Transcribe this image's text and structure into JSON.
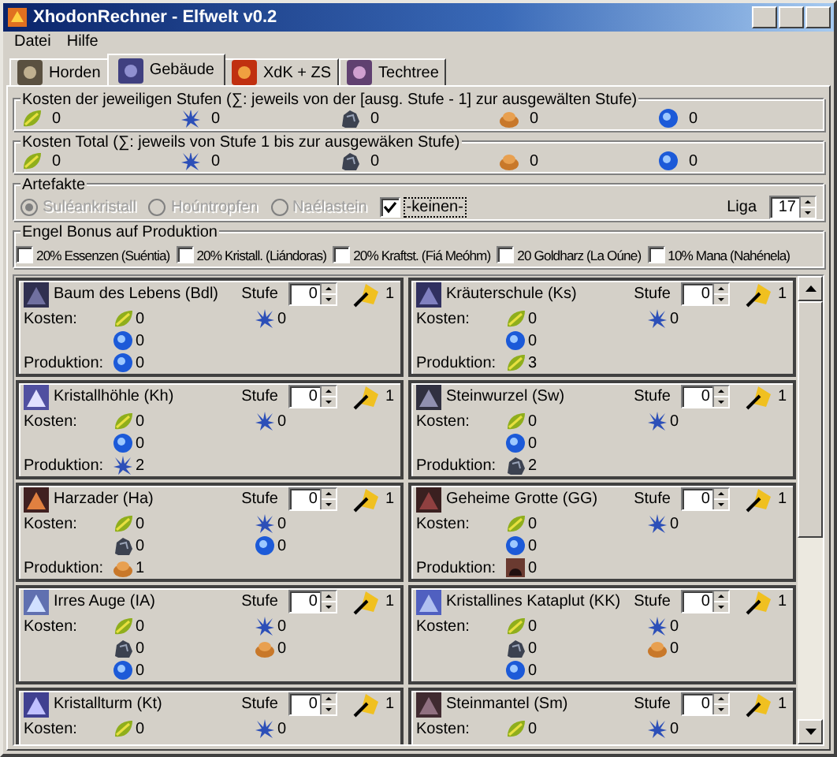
{
  "window": {
    "title": "XhodonRechner - Elfwelt v0.2"
  },
  "menu": [
    "Datei",
    "Hilfe"
  ],
  "tabs": [
    {
      "label": "Horden",
      "selected": false
    },
    {
      "label": "Gebäude",
      "selected": true
    },
    {
      "label": "XdK + ZS",
      "selected": false
    },
    {
      "label": "Techtree",
      "selected": false
    }
  ],
  "level_costs": {
    "title": "Kosten der jeweiligen Stufen (∑: jeweils von der [ausg. Stufe - 1] zur ausgewälten Stufe)",
    "values": [
      {
        "kind": "essence",
        "value": "0"
      },
      {
        "kind": "crystal",
        "value": "0"
      },
      {
        "kind": "stone",
        "value": "0"
      },
      {
        "kind": "resin",
        "value": "0"
      },
      {
        "kind": "mana",
        "value": "0"
      }
    ]
  },
  "total_costs": {
    "title": "Kosten Total (∑: jeweils von Stufe 1 bis zur ausgewäken Stufe)",
    "values": [
      {
        "kind": "essence",
        "value": "0"
      },
      {
        "kind": "crystal",
        "value": "0"
      },
      {
        "kind": "stone",
        "value": "0"
      },
      {
        "kind": "resin",
        "value": "0"
      },
      {
        "kind": "mana",
        "value": "0"
      }
    ]
  },
  "artifacts": {
    "title": "Artefakte",
    "options": [
      {
        "label": "Suléankristall",
        "selected": true,
        "disabled": true
      },
      {
        "label": "Hoúntropfen",
        "selected": false,
        "disabled": true
      },
      {
        "label": "Naélastein",
        "selected": false,
        "disabled": true
      }
    ],
    "none_option": {
      "label": "-keinen-",
      "checked": true
    },
    "league": {
      "label": "Liga",
      "value": "17"
    }
  },
  "angel_bonus": {
    "title": "Engel Bonus auf Produktion",
    "options": [
      {
        "label": "20% Essenzen (Suéntia)",
        "checked": false
      },
      {
        "label": "20% Kristall. (Liándoras)",
        "checked": false
      },
      {
        "label": "20% Kraftst. (Fiá Meóhm)",
        "checked": false
      },
      {
        "label": "20 Goldharz (La Oúne)",
        "checked": false
      },
      {
        "label": "10% Mana (Nahénela)",
        "checked": false
      }
    ]
  },
  "buildings": [
    {
      "name": "Baum des Lebens (Bdl)",
      "level_label": "Stufe",
      "level": "0",
      "count": "1",
      "costs_label": "Kosten:",
      "costs": [
        {
          "kind": "essence",
          "value": "0"
        },
        {
          "kind": "crystal",
          "value": "0"
        },
        {
          "kind": "mana",
          "value": "0"
        }
      ],
      "production_label": "Produktion:",
      "production": {
        "kind": "mana",
        "value": "0"
      }
    },
    {
      "name": "Kräuterschule (Ks)",
      "level_label": "Stufe",
      "level": "0",
      "count": "1",
      "costs_label": "Kosten:",
      "costs": [
        {
          "kind": "essence",
          "value": "0"
        },
        {
          "kind": "crystal",
          "value": "0"
        },
        {
          "kind": "mana",
          "value": "0"
        }
      ],
      "production_label": "Produktion:",
      "production": {
        "kind": "essence",
        "value": "3"
      }
    },
    {
      "name": "Kristallhöhle (Kh)",
      "level_label": "Stufe",
      "level": "0",
      "count": "1",
      "costs_label": "Kosten:",
      "costs": [
        {
          "kind": "essence",
          "value": "0"
        },
        {
          "kind": "crystal",
          "value": "0"
        },
        {
          "kind": "mana",
          "value": "0"
        }
      ],
      "production_label": "Produktion:",
      "production": {
        "kind": "crystal",
        "value": "2"
      }
    },
    {
      "name": "Steinwurzel (Sw)",
      "level_label": "Stufe",
      "level": "0",
      "count": "1",
      "costs_label": "Kosten:",
      "costs": [
        {
          "kind": "essence",
          "value": "0"
        },
        {
          "kind": "crystal",
          "value": "0"
        },
        {
          "kind": "mana",
          "value": "0"
        }
      ],
      "production_label": "Produktion:",
      "production": {
        "kind": "stone",
        "value": "2"
      }
    },
    {
      "name": "Harzader (Ha)",
      "level_label": "Stufe",
      "level": "0",
      "count": "1",
      "costs_label": "Kosten:",
      "costs": [
        {
          "kind": "essence",
          "value": "0"
        },
        {
          "kind": "crystal",
          "value": "0"
        },
        {
          "kind": "stone",
          "value": "0"
        },
        {
          "kind": "mana",
          "value": "0"
        }
      ],
      "production_label": "Produktion:",
      "production": {
        "kind": "resin",
        "value": "1"
      }
    },
    {
      "name": "Geheime Grotte (GG)",
      "level_label": "Stufe",
      "level": "0",
      "count": "1",
      "costs_label": "Kosten:",
      "costs": [
        {
          "kind": "essence",
          "value": "0"
        },
        {
          "kind": "crystal",
          "value": "0"
        },
        {
          "kind": "mana",
          "value": "0"
        }
      ],
      "production_label": "Produktion:",
      "production": {
        "kind": "cave",
        "value": "0"
      }
    },
    {
      "name": "Irres Auge (IA)",
      "level_label": "Stufe",
      "level": "0",
      "count": "1",
      "costs_label": "Kosten:",
      "costs": [
        {
          "kind": "essence",
          "value": "0"
        },
        {
          "kind": "crystal",
          "value": "0"
        },
        {
          "kind": "stone",
          "value": "0"
        },
        {
          "kind": "resin",
          "value": "0"
        },
        {
          "kind": "mana",
          "value": "0"
        }
      ]
    },
    {
      "name": "Kristallines Kataplut (KK)",
      "level_label": "Stufe",
      "level": "0",
      "count": "1",
      "costs_label": "Kosten:",
      "costs": [
        {
          "kind": "essence",
          "value": "0"
        },
        {
          "kind": "crystal",
          "value": "0"
        },
        {
          "kind": "stone",
          "value": "0"
        },
        {
          "kind": "resin",
          "value": "0"
        },
        {
          "kind": "mana",
          "value": "0"
        }
      ]
    },
    {
      "name": "Kristallturm (Kt)",
      "level_label": "Stufe",
      "level": "0",
      "count": "1",
      "costs_label": "Kosten:",
      "costs": [
        {
          "kind": "essence",
          "value": "0"
        },
        {
          "kind": "crystal",
          "value": "0"
        }
      ]
    },
    {
      "name": "Steinmantel (Sm)",
      "level_label": "Stufe",
      "level": "0",
      "count": "1",
      "costs_label": "Kosten:",
      "costs": [
        {
          "kind": "essence",
          "value": "0"
        },
        {
          "kind": "crystal",
          "value": "0"
        }
      ]
    }
  ]
}
